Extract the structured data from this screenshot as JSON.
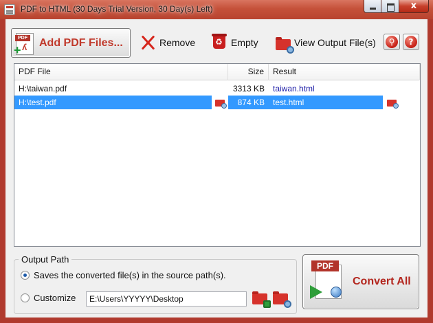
{
  "window": {
    "title": "PDF to HTML (30 Days Trial Version, 30 Day(s) Left)",
    "close_glyph": "x"
  },
  "toolbar": {
    "add_label": "Add PDF Files...",
    "remove_label": "Remove",
    "empty_label": "Empty",
    "view_output_label": "View Output File(s)",
    "register_glyph": "⚲",
    "help_glyph": "?"
  },
  "file_list": {
    "columns": [
      "PDF File",
      "Size",
      "Result"
    ],
    "rows": [
      {
        "file": "H:\\taiwan.pdf",
        "size": "3313 KB",
        "result": "taiwan.html",
        "selected": false
      },
      {
        "file": "H:\\test.pdf",
        "size": "874 KB",
        "result": "test.html",
        "selected": true
      }
    ]
  },
  "output_path": {
    "group_label": "Output Path",
    "option_source_label": "Saves the converted file(s) in the source path(s).",
    "option_custom_label": "Customize",
    "custom_path_value": "E:\\Users\\YYYYY\\Desktop",
    "selected_option": "source"
  },
  "convert": {
    "label": "Convert All"
  },
  "colors": {
    "accent_red": "#c0392b",
    "selection_blue": "#3399ff",
    "link_blue": "#1a1aa6"
  },
  "icons": {
    "add": "pdf-add-icon",
    "remove": "red-x-icon",
    "empty": "recycle-bin-icon",
    "view_output": "folder-search-icon",
    "register": "key-icon",
    "help": "help-icon",
    "browse": "folder-down-icon",
    "open_folder": "folder-search-icon",
    "convert": "pdf-to-html-icon"
  }
}
